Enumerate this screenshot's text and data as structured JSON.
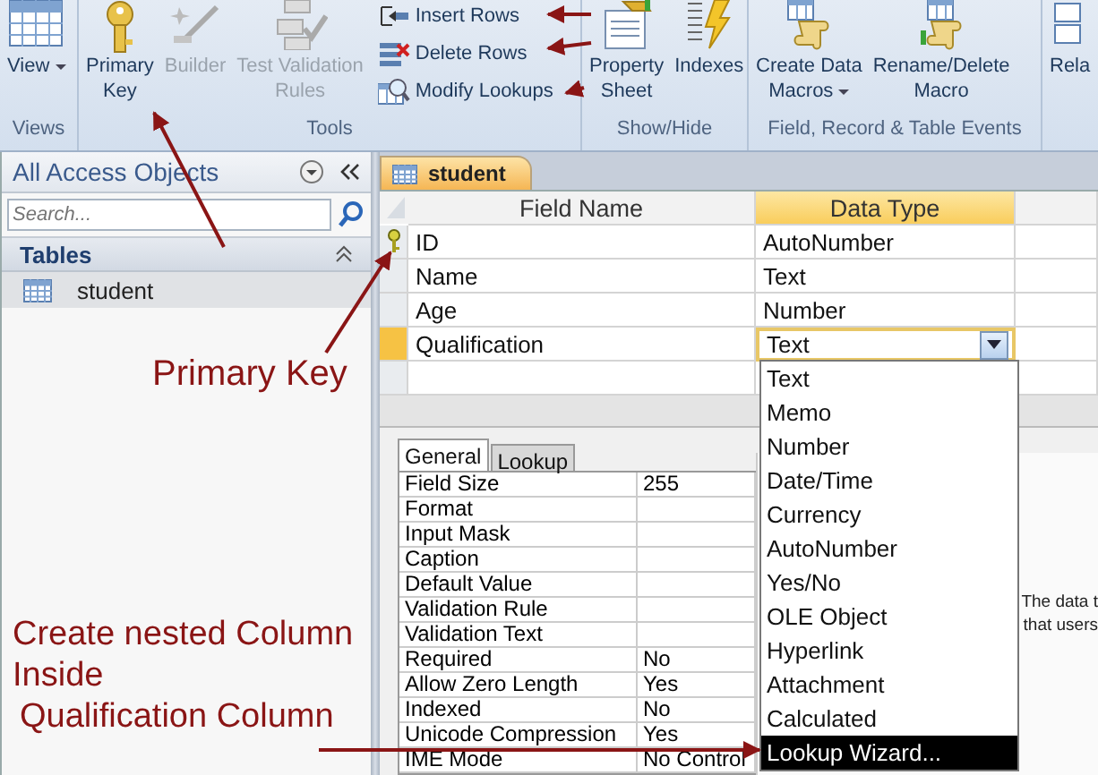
{
  "ribbon": {
    "groups": [
      {
        "label": "Views",
        "buttons": [
          {
            "kind": "large",
            "lines": [
              "View"
            ],
            "dropdown": true,
            "disabled": false
          }
        ]
      },
      {
        "label": "Tools",
        "buttons": [
          {
            "kind": "large",
            "lines": [
              "Primary",
              "Key"
            ],
            "disabled": false
          },
          {
            "kind": "large",
            "lines": [
              "Builder"
            ],
            "disabled": true
          },
          {
            "kind": "large",
            "lines": [
              "Test Validation",
              "Rules"
            ],
            "disabled": true
          },
          {
            "kind": "small",
            "lines": [
              "Insert Rows"
            ],
            "disabled": false
          },
          {
            "kind": "small",
            "lines": [
              "Delete Rows"
            ],
            "disabled": false
          },
          {
            "kind": "small",
            "lines": [
              "Modify Lookups"
            ],
            "disabled": false
          }
        ]
      },
      {
        "label": "Show/Hide",
        "buttons": [
          {
            "kind": "large",
            "lines": [
              "Property",
              "Sheet"
            ],
            "disabled": false
          },
          {
            "kind": "large",
            "lines": [
              "Indexes"
            ],
            "disabled": false
          }
        ]
      },
      {
        "label": "Field, Record & Table Events",
        "buttons": [
          {
            "kind": "large",
            "lines": [
              "Create Data",
              "Macros"
            ],
            "dropdown": true,
            "disabled": false
          },
          {
            "kind": "large",
            "lines": [
              "Rename/Delete",
              "Macro"
            ],
            "disabled": false
          }
        ]
      },
      {
        "buttons": [
          {
            "kind": "large",
            "lines": [
              "Rela"
            ],
            "disabled": false
          }
        ]
      }
    ]
  },
  "nav": {
    "title": "All Access Objects",
    "search": {
      "placeholder": "Search..."
    },
    "groups": [
      {
        "label": "Tables",
        "expanded": true,
        "items": [
          {
            "label": "student",
            "selected": true
          }
        ]
      }
    ]
  },
  "document": {
    "tab": {
      "label": "student",
      "selected": true
    },
    "columns": [
      "Field Name",
      "Data Type"
    ],
    "rows": [
      {
        "field_name": "ID",
        "data_type": "AutoNumber",
        "primary_key": true,
        "current": false
      },
      {
        "field_name": "Name",
        "data_type": "Text",
        "primary_key": false,
        "current": false
      },
      {
        "field_name": "Age",
        "data_type": "Number",
        "primary_key": false,
        "current": false
      },
      {
        "field_name": "Qualification",
        "data_type": "Text",
        "primary_key": false,
        "current": true
      }
    ],
    "type_options": [
      {
        "label": "Text",
        "selected": false
      },
      {
        "label": "Memo",
        "selected": false
      },
      {
        "label": "Number",
        "selected": false
      },
      {
        "label": "Date/Time",
        "selected": false
      },
      {
        "label": "Currency",
        "selected": false
      },
      {
        "label": "AutoNumber",
        "selected": false
      },
      {
        "label": "Yes/No",
        "selected": false
      },
      {
        "label": "OLE Object",
        "selected": false
      },
      {
        "label": "Hyperlink",
        "selected": false
      },
      {
        "label": "Attachment",
        "selected": false
      },
      {
        "label": "Calculated",
        "selected": false
      },
      {
        "label": "Lookup Wizard...",
        "selected": true
      }
    ]
  },
  "properties": {
    "tabs": [
      {
        "label": "General",
        "selected": true
      },
      {
        "label": "Lookup",
        "selected": false
      }
    ],
    "rows": [
      {
        "name": "Field Size",
        "value": "255"
      },
      {
        "name": "Format"
      },
      {
        "name": "Input Mask"
      },
      {
        "name": "Caption"
      },
      {
        "name": "Default Value"
      },
      {
        "name": "Validation Rule"
      },
      {
        "name": "Validation Text"
      },
      {
        "name": "Required",
        "value": "No"
      },
      {
        "name": "Allow Zero Length",
        "value": "Yes"
      },
      {
        "name": "Indexed",
        "value": "No"
      },
      {
        "name": "Unicode Compression",
        "value": "Yes"
      },
      {
        "name": "IME Mode",
        "value": "No Control"
      }
    ],
    "help_lines": [
      "The data t",
      "that users"
    ]
  },
  "notes": [
    {
      "lines": [
        "Primary Key"
      ]
    },
    {
      "lines": [
        "Create nested Column",
        "Inside",
        "Qualification Column"
      ]
    }
  ]
}
